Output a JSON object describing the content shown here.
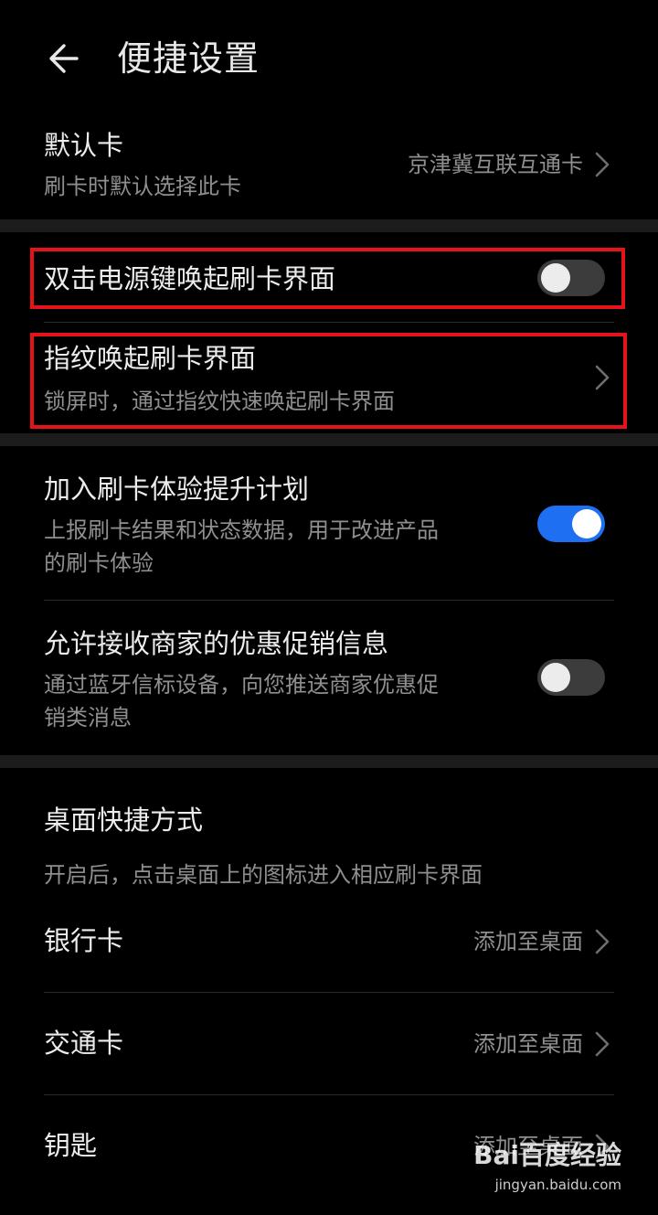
{
  "header": {
    "title": "便捷设置"
  },
  "default_card": {
    "title": "默认卡",
    "subtitle": "刷卡时默认选择此卡",
    "value": "京津冀互联互通卡"
  },
  "double_press": {
    "title": "双击电源键唤起刷卡界面",
    "enabled": false
  },
  "fingerprint": {
    "title": "指纹唤起刷卡界面",
    "subtitle": "锁屏时，通过指纹快速唤起刷卡界面"
  },
  "experience_plan": {
    "title": "加入刷卡体验提升计划",
    "subtitle_line1": "上报刷卡结果和状态数据，用于改进产品",
    "subtitle_line2": "的刷卡体验",
    "enabled": true
  },
  "promotions": {
    "title": "允许接收商家的优惠促销信息",
    "subtitle_line1": "通过蓝牙信标设备，向您推送商家优惠促",
    "subtitle_line2": "销类消息",
    "enabled": false
  },
  "shortcuts": {
    "title": "桌面快捷方式",
    "description": "开启后，点击桌面上的图标进入相应刷卡界面",
    "items": [
      {
        "label": "银行卡",
        "action": "添加至桌面"
      },
      {
        "label": "交通卡",
        "action": "添加至桌面"
      },
      {
        "label": "钥匙",
        "action": "添加至桌面"
      }
    ]
  },
  "watermark": {
    "logo": "Bai百度经验",
    "url": "jingyan.baidu.com"
  },
  "colors": {
    "background": "#000000",
    "accent": "#1f6ff2",
    "highlight": "#e5141b",
    "section_gap": "#1c1c1c"
  }
}
